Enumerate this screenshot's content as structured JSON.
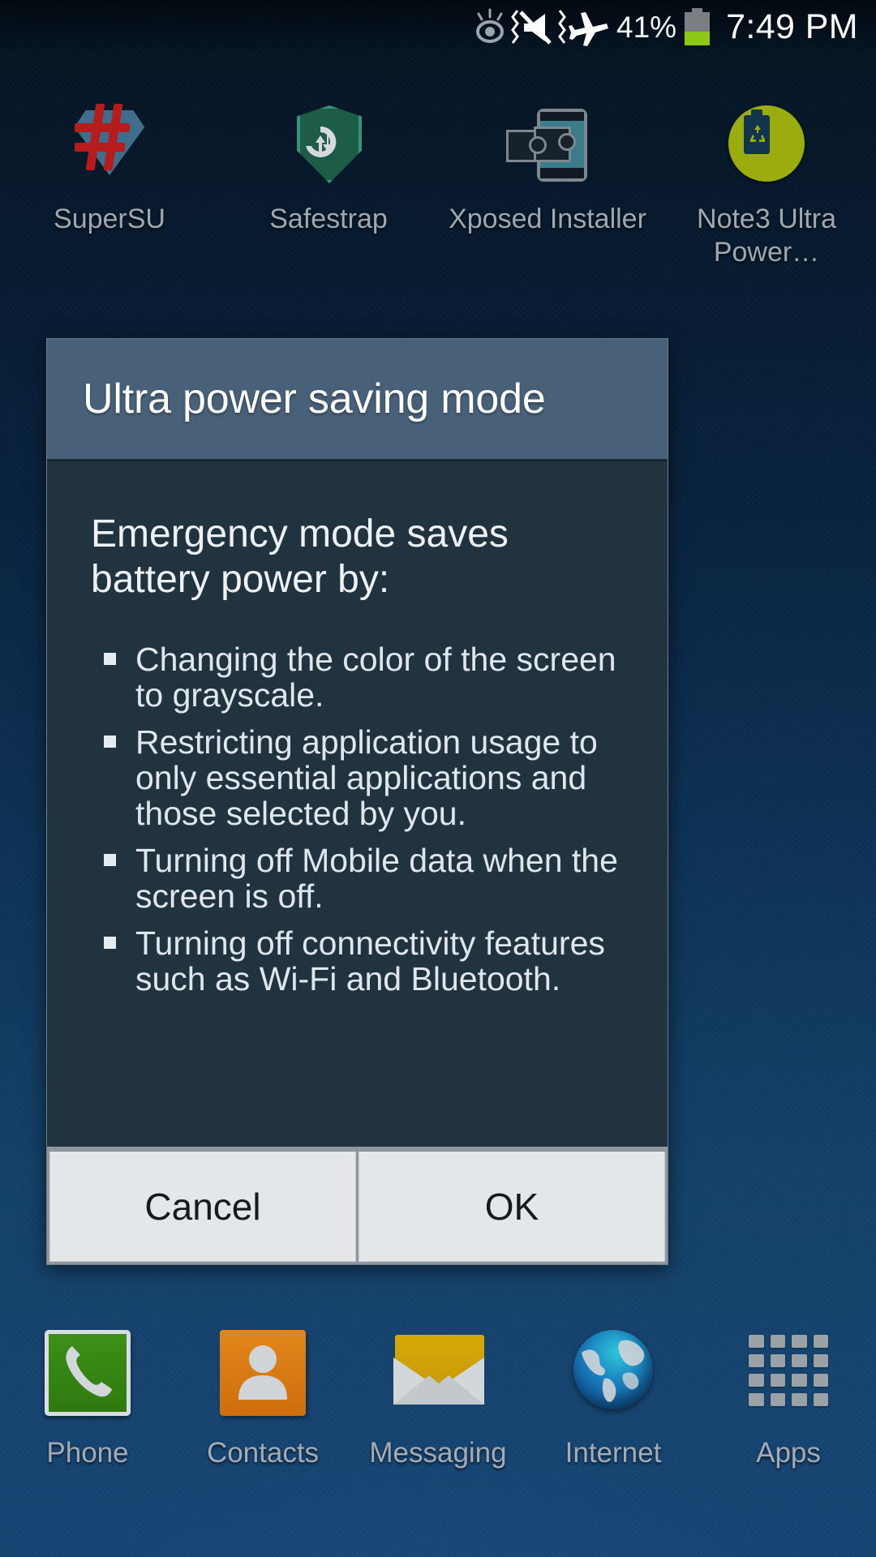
{
  "status_bar": {
    "icons": [
      {
        "name": "smart-stay-eye-icon",
        "label": "Smart stay"
      },
      {
        "name": "mute-vibrate-icon",
        "label": "Sound off with vibrate"
      },
      {
        "name": "airplane-mode-icon",
        "label": "Airplane mode"
      }
    ],
    "battery_percent": "41%",
    "battery_level": 41,
    "battery_fill_color": "#8cc916",
    "time": "7:49 PM"
  },
  "home_apps": [
    {
      "label": "SuperSU",
      "icon": "supersu-icon"
    },
    {
      "label": "Safestrap",
      "icon": "safestrap-icon"
    },
    {
      "label": "Xposed Installer",
      "icon": "xposed-installer-icon"
    },
    {
      "label": "Note3 Ultra Power…",
      "icon": "note3-ultra-power-icon"
    }
  ],
  "dialog": {
    "title": "Ultra power saving mode",
    "intro": "Emergency mode saves battery power by:",
    "bullets": [
      "Changing the color of the screen to grayscale.",
      "Restricting application usage to only essential applications and those selected by you.",
      "Turning off Mobile data when the screen is off.",
      "Turning off connectivity features such as Wi-Fi and Bluetooth."
    ],
    "cancel_label": "Cancel",
    "ok_label": "OK",
    "title_bar_color": "#486179",
    "body_color": "#223340",
    "button_color": "#e3e7e9"
  },
  "dock": [
    {
      "label": "Phone",
      "icon": "phone-icon"
    },
    {
      "label": "Contacts",
      "icon": "contacts-icon"
    },
    {
      "label": "Messaging",
      "icon": "messaging-icon"
    },
    {
      "label": "Internet",
      "icon": "internet-globe-icon"
    },
    {
      "label": "Apps",
      "icon": "apps-grid-icon"
    }
  ]
}
